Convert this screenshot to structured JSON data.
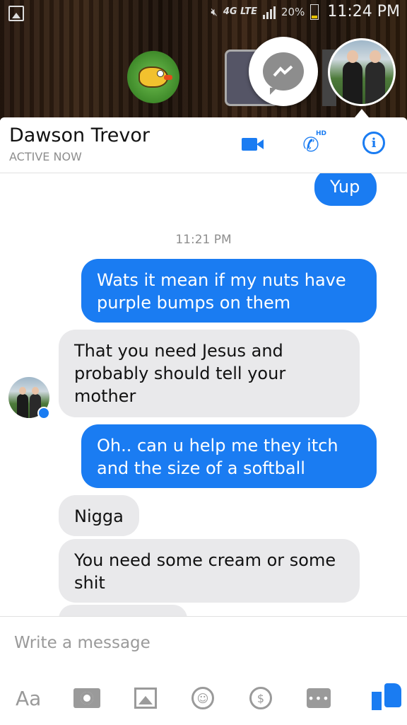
{
  "status_bar": {
    "network": "4G LTE",
    "battery": "20%",
    "time": "11:24 PM"
  },
  "header": {
    "contact_name": "Dawson Trevor",
    "status": "ACTIVE NOW",
    "hd_badge": "HD",
    "info_glyph": "i"
  },
  "thread": {
    "timestamp": "11:21 PM",
    "messages": [
      {
        "from": "me",
        "text": "Yup"
      },
      {
        "from": "me",
        "text": "Wats it mean if my nuts have purple bumps on them"
      },
      {
        "from": "them",
        "text": "That you need Jesus and probably should tell your mother"
      },
      {
        "from": "me",
        "text": "Oh.. can u help me they itch and the size of a softball"
      },
      {
        "from": "them",
        "text": "Nigga"
      },
      {
        "from": "them",
        "text": "You need some cream or some shit"
      }
    ]
  },
  "compose": {
    "placeholder": "Write a message",
    "aa_label": "Aa",
    "money_glyph": "$",
    "more_glyph": "•••"
  },
  "icons": {
    "accent": "#1a7cf2",
    "outgoing_bubble": "#1a7cf2",
    "incoming_bubble": "#e9e9eb"
  }
}
